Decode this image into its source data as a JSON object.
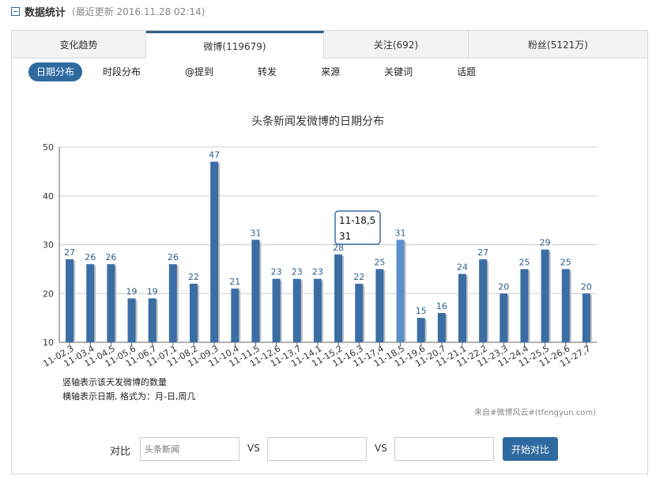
{
  "header": {
    "title": "数据统计",
    "updated": "(最近更新  2016.11.28 02:14)"
  },
  "tabs": [
    "变化趋势",
    "微博(119679)",
    "关注(692)",
    "粉丝(5121万)"
  ],
  "subtabs": [
    "日期分布",
    "时段分布",
    "@提到",
    "转发",
    "来源",
    "关键词",
    "话题"
  ],
  "chart_data": {
    "type": "bar",
    "title": "头条新闻发微博的日期分布",
    "categories": [
      "11-02,3",
      "11-03,4",
      "11-04,5",
      "11-05,6",
      "11-06,7",
      "11-07,1",
      "11-08,2",
      "11-09,3",
      "11-10,4",
      "11-11,5",
      "11-12,6",
      "11-13,7",
      "11-14,1",
      "11-15,2",
      "11-16,3",
      "11-17,4",
      "11-18,5",
      "11-19,6",
      "11-20,7",
      "11-21,1",
      "11-22,2",
      "11-23,3",
      "11-24,4",
      "11-25,5",
      "11-26,6",
      "11-27,7"
    ],
    "values": [
      27,
      26,
      26,
      19,
      19,
      26,
      22,
      47,
      21,
      31,
      23,
      23,
      23,
      28,
      22,
      25,
      31,
      15,
      16,
      24,
      27,
      20,
      25,
      29,
      25,
      20
    ],
    "yticks": [
      10,
      20,
      30,
      40,
      50
    ],
    "ylim": [
      10,
      50
    ],
    "grid": true,
    "bar_color": "#3a6ea5",
    "highlight_color": "#5b8fc9",
    "label_color": "#2e5f8f",
    "tooltip": {
      "line1": "11-18,5",
      "line2": "31"
    }
  },
  "notes": [
    "竖轴表示该天发微博的数量",
    "横轴表示日期, 格式为：月-日,周几"
  ],
  "credit": "来自#微博风云#(tfengyun.com)",
  "compare": {
    "label": "对比",
    "field1_placeholder": "头条新闻",
    "vs": "VS",
    "button": "开始对比"
  }
}
